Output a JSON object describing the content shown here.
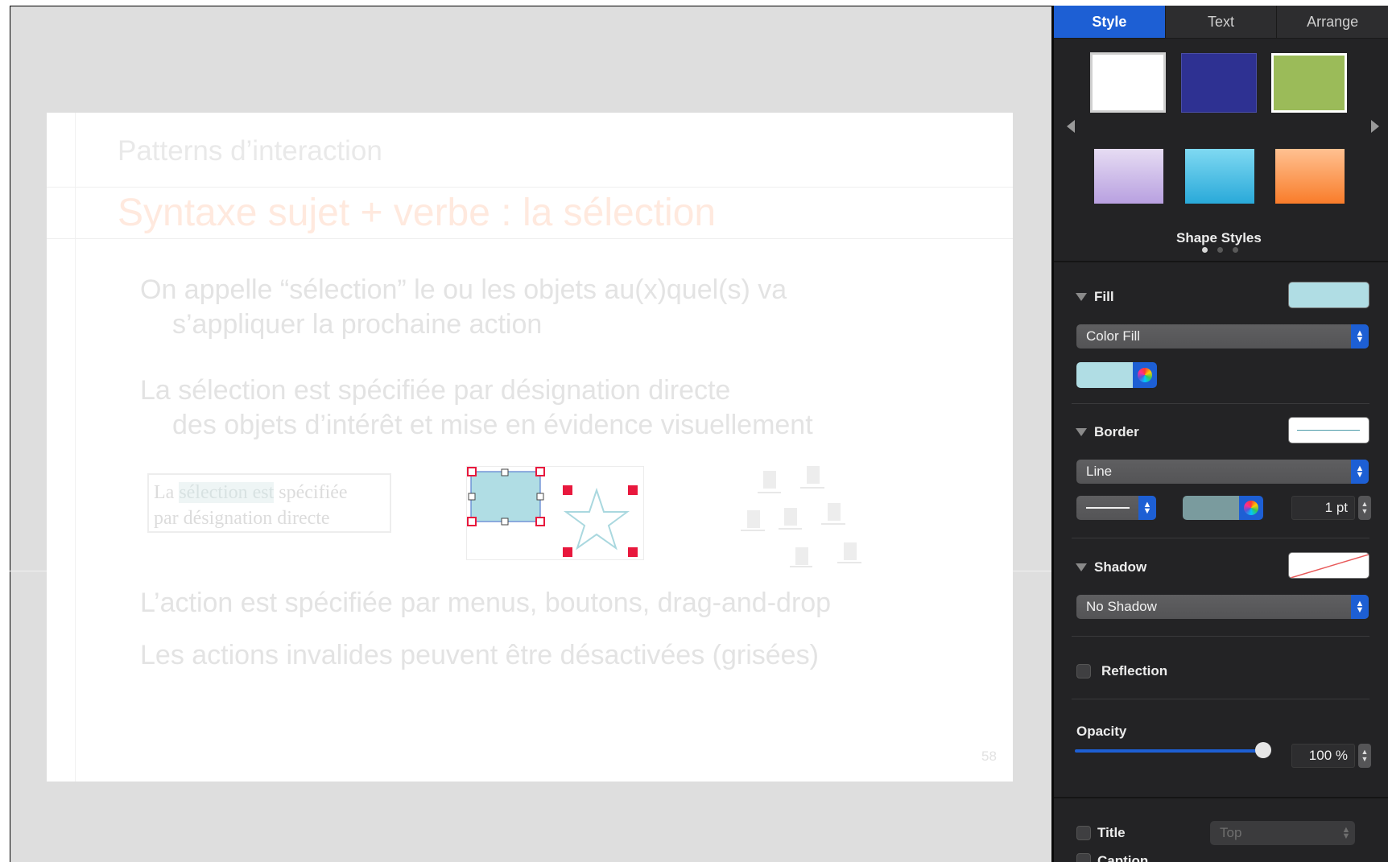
{
  "slide": {
    "subtitle": "Patterns d’interaction",
    "title": "Syntaxe sujet + verbe : la sélection",
    "bullets": [
      {
        "line1": "On appelle “sélection” le ou les objets au(x)quel(s) va",
        "line2": "s’appliquer la prochaine action"
      },
      {
        "line1": "La sélection est spécifiée par désignation directe",
        "line2": "des objets d’intérêt et mise en évidence visuellement"
      },
      {
        "line1": "L’action est spécifiée par menus, boutons, drag-and-drop",
        "line2": ""
      },
      {
        "line1": "Les actions invalides peuvent être désactivées (grisées)",
        "line2": ""
      }
    ],
    "demo_text": {
      "before": "La ",
      "highlight": "sélection est",
      "after": " spécifiée",
      "line2": "par désignation directe"
    },
    "page_number": "58"
  },
  "inspector": {
    "tabs": [
      {
        "label": "Style",
        "active": true
      },
      {
        "label": "Text",
        "active": false
      },
      {
        "label": "Arrange",
        "active": false
      }
    ],
    "shape_styles_label": "Shape Styles",
    "swatches": [
      {
        "name": "white",
        "color": "#ffffff"
      },
      {
        "name": "navy",
        "color": "#2e3192"
      },
      {
        "name": "green",
        "color": "#9bbb59"
      },
      {
        "name": "lavender",
        "color": "#c7b3e6"
      },
      {
        "name": "sky",
        "color": "#4cc3e6"
      },
      {
        "name": "orange",
        "color": "#fb9a4e"
      }
    ],
    "fill": {
      "label": "Fill",
      "type": "Color Fill",
      "color": "#b0dde4"
    },
    "border": {
      "label": "Border",
      "type": "Line",
      "width": "1 pt",
      "color": "#7a9b9e"
    },
    "shadow": {
      "label": "Shadow",
      "type": "No Shadow"
    },
    "reflection": {
      "label": "Reflection"
    },
    "opacity": {
      "label": "Opacity",
      "value": "100 %"
    },
    "title": {
      "label": "Title",
      "position": "Top"
    },
    "caption": {
      "label": "Caption"
    }
  }
}
